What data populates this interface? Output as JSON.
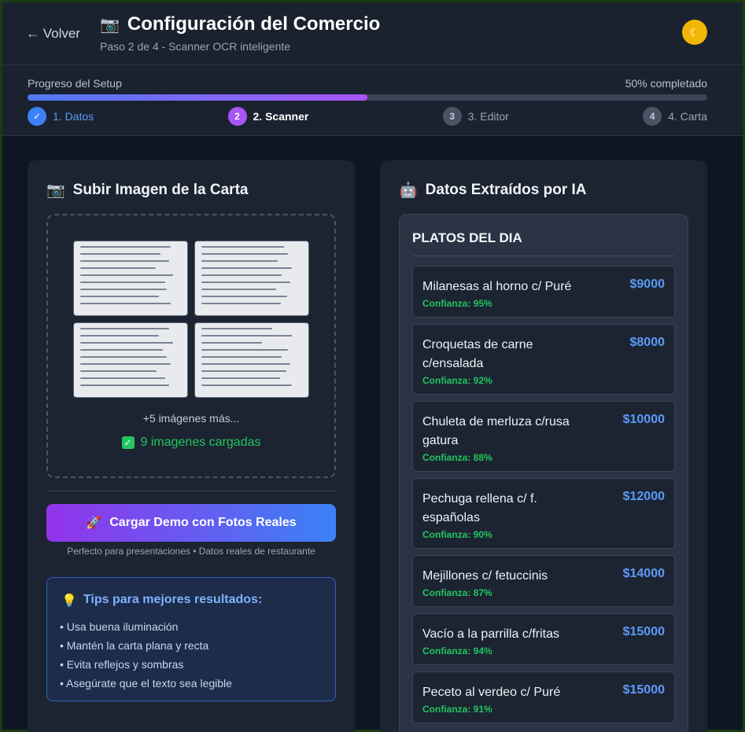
{
  "header": {
    "back_label": "← Volver",
    "title_icon": "camera-icon",
    "title": "Configuración del Comercio",
    "subtitle": "Paso 2 de 4 - Scanner OCR inteligente",
    "theme_icon": "moon-icon"
  },
  "progress": {
    "label": "Progreso del Setup",
    "status": "50% completado",
    "fraction": 0.5,
    "steps": [
      {
        "label": "1. Datos",
        "marker": "✓",
        "state": "done"
      },
      {
        "label": "2. Scanner",
        "marker": "2",
        "state": "active"
      },
      {
        "label": "3. Editor",
        "marker": "3",
        "state": "pending"
      },
      {
        "label": "4. Carta",
        "marker": "4",
        "state": "pending"
      }
    ]
  },
  "upload_panel": {
    "title": "Subir Imagen de la Carta",
    "title_icon": "camera-icon",
    "more_images": "+5 imágenes más...",
    "loaded_text": "9 imagenes cargadas",
    "demo_button": "Cargar Demo con Fotos Reales",
    "demo_icon": "rocket-icon",
    "demo_note": "Perfecto para presentaciones • Datos reales de restaurante",
    "tips_title": "Tips para mejores resultados:",
    "tips_icon": "lightbulb-icon",
    "tips": [
      "Usa buena iluminación",
      "Mantén la carta plana y recta",
      "Evita reflejos y sombras",
      "Asegúrate que el texto sea legible"
    ]
  },
  "extract_panel": {
    "title": "Datos Extraídos por IA",
    "title_icon": "robot-icon",
    "section": "PLATOS DEL DIA",
    "dishes": [
      {
        "name": "Milanesas al horno c/ Puré",
        "price": "$9000",
        "confidence": "Confianza: 95%"
      },
      {
        "name": "Croquetas de carne c/ensalada",
        "price": "$8000",
        "confidence": "Confianza: 92%"
      },
      {
        "name": "Chuleta de merluza c/rusa gatura",
        "price": "$10000",
        "confidence": "Confianza: 88%"
      },
      {
        "name": "Pechuga rellena c/ f. españolas",
        "price": "$12000",
        "confidence": "Confianza: 90%"
      },
      {
        "name": "Mejillones c/ fetuccinis",
        "price": "$14000",
        "confidence": "Confianza: 87%"
      },
      {
        "name": "Vacío a la parrilla c/fritas",
        "price": "$15000",
        "confidence": "Confianza: 94%"
      },
      {
        "name": "Peceto al verdeo c/ Puré",
        "price": "$15000",
        "confidence": "Confianza: 91%"
      }
    ]
  }
}
